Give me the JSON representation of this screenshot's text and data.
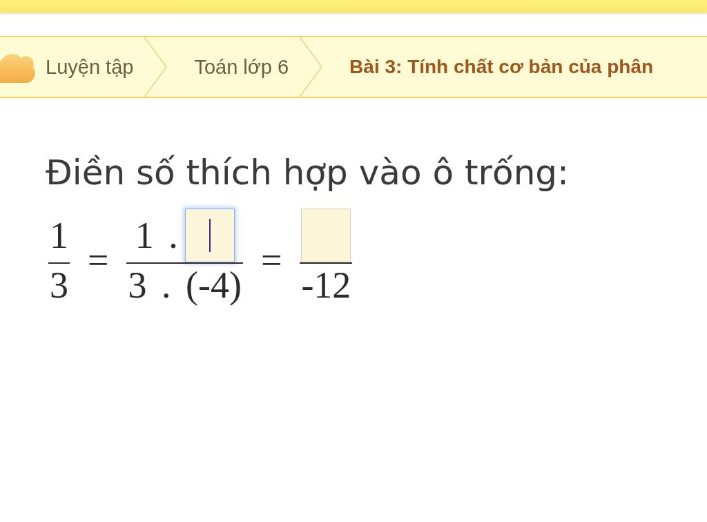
{
  "breadcrumb": {
    "items": [
      {
        "label": "Luyện tập",
        "selected": false
      },
      {
        "label": "Toán lớp 6",
        "selected": false
      },
      {
        "label": "Bài 3: Tính chất cơ bản của phân",
        "selected": true
      }
    ]
  },
  "question": {
    "prompt": "Điền số thích hợp vào ô trống:",
    "equation": [
      {
        "kind": "fraction",
        "numerator": [
          {
            "kind": "text",
            "text": "1"
          }
        ],
        "denominator": [
          {
            "kind": "text",
            "text": "3"
          }
        ]
      },
      {
        "kind": "operator",
        "text": "="
      },
      {
        "kind": "fraction",
        "numerator": [
          {
            "kind": "text",
            "text": "1 ."
          },
          {
            "kind": "blank",
            "focused": true
          }
        ],
        "denominator": [
          {
            "kind": "text",
            "text": "3 . (-4)"
          }
        ]
      },
      {
        "kind": "operator",
        "text": "="
      },
      {
        "kind": "fraction",
        "numerator": [
          {
            "kind": "blank",
            "focused": false
          }
        ],
        "denominator": [
          {
            "kind": "text",
            "text": "-12"
          }
        ]
      }
    ]
  }
}
